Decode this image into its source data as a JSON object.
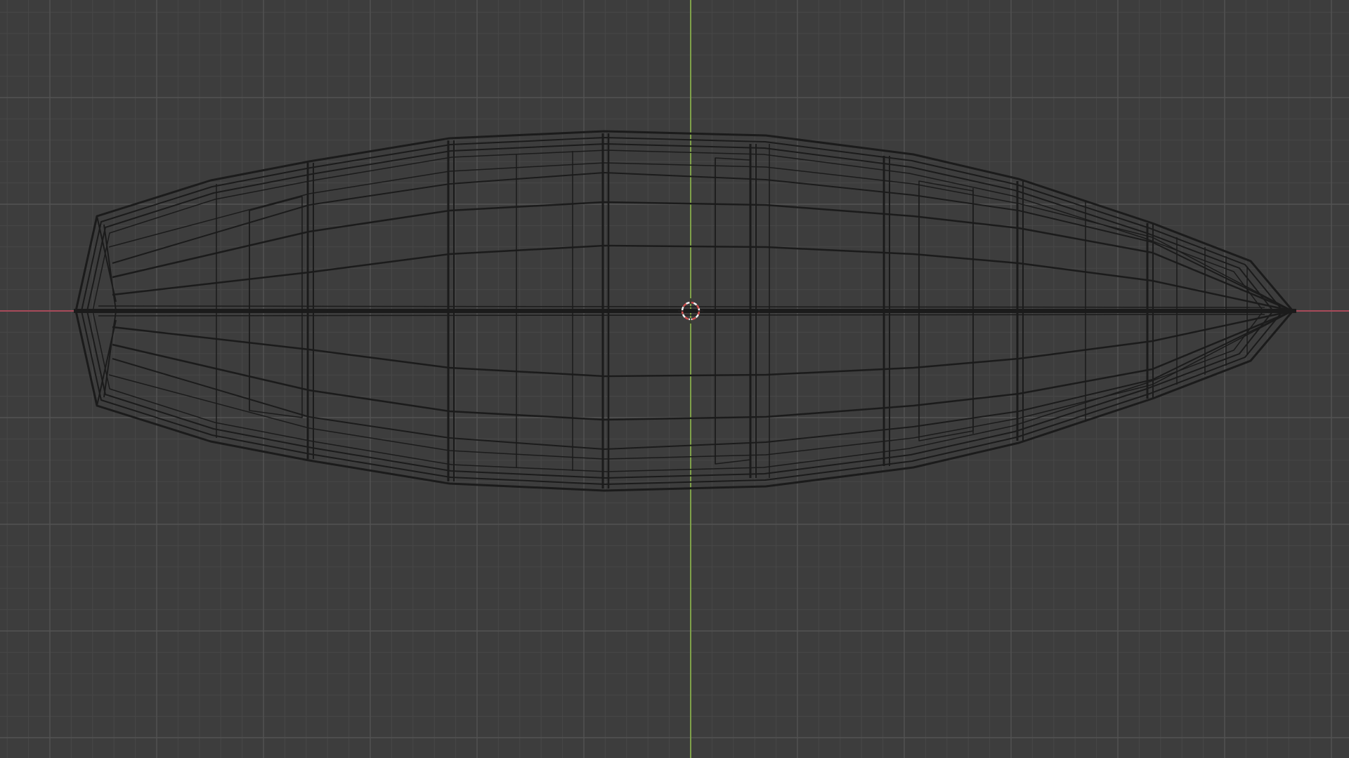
{
  "viewport": {
    "view": "top-orthographic",
    "shading": "wireframe",
    "object": "boat-hull",
    "colors": {
      "background": "#3d3d3d",
      "grid_minor": "#474747",
      "grid_major": "#535353",
      "axis_x": "#a84a5a",
      "axis_y": "#7fa14a",
      "wire": "#1b1b1b",
      "cursor_red": "#d05050",
      "cursor_white": "#f0f0f0"
    }
  }
}
